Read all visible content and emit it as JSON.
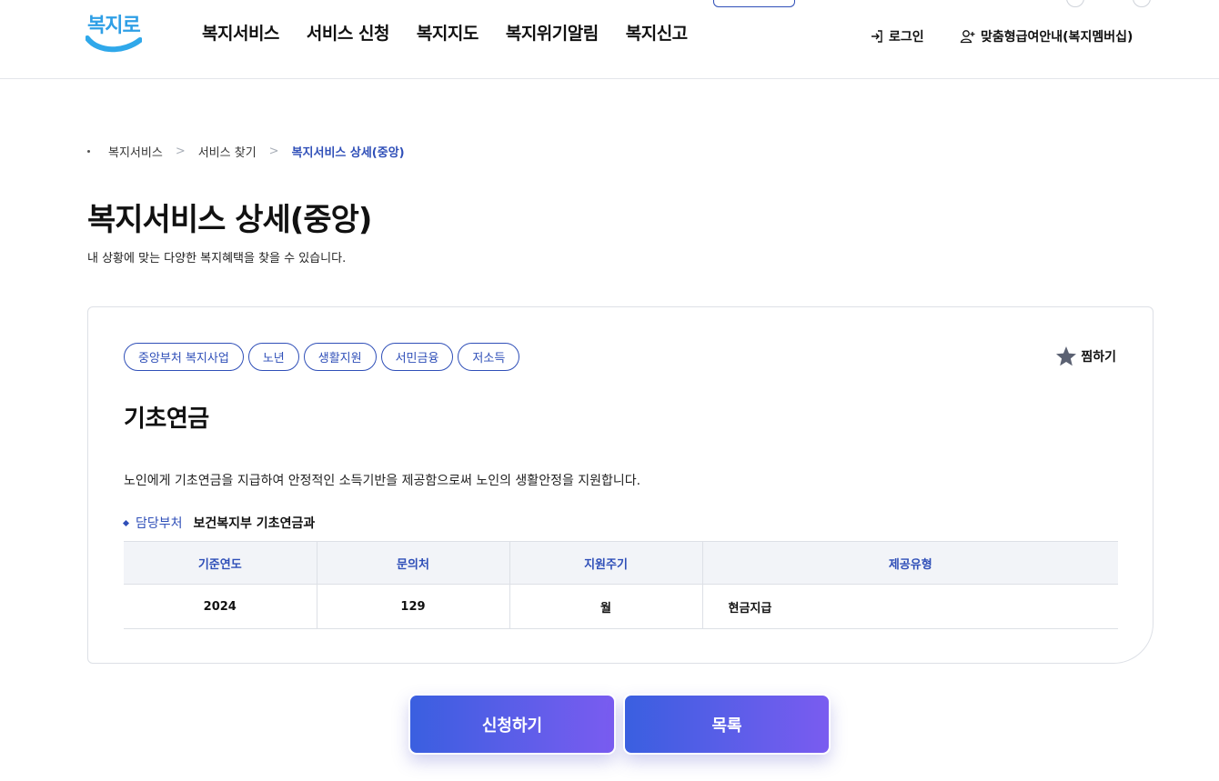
{
  "header": {
    "logo_text": "복지로",
    "nav": [
      {
        "label": "복지서비스"
      },
      {
        "label": "서비스 신청"
      },
      {
        "label": "복지지도"
      },
      {
        "label": "복지위기알림"
      },
      {
        "label": "복지신고"
      }
    ],
    "login_label": "로그인",
    "membership_label": "맞춤형급여안내(복지멤버십)",
    "icons": [
      "login-icon",
      "user-add-icon"
    ]
  },
  "breadcrumb": {
    "items": [
      "복지서비스",
      "서비스 찾기",
      "복지서비스 상세(중앙)"
    ],
    "separator": ">"
  },
  "page": {
    "title": "복지서비스 상세(중앙)",
    "description": "내 상황에 맞는 다양한 복지혜택을 찾을 수 있습니다."
  },
  "service": {
    "tags": [
      "중앙부처 복지사업",
      "노년",
      "생활지원",
      "서민금융",
      "저소득"
    ],
    "bookmark_label": "찜하기",
    "title": "기초연금",
    "description": "노인에게 기초연금을 지급하여 안정적인 소득기반을 제공함으로써 노인의 생활안정을 지원합니다.",
    "department_label": "담당부처",
    "department_value": "보건복지부 기초연금과",
    "table": {
      "headers": [
        "기준연도",
        "문의처",
        "지원주기",
        "제공유형"
      ],
      "row": [
        "2024",
        "129",
        "월",
        "현금지급"
      ]
    }
  },
  "actions": {
    "apply_label": "신청하기",
    "list_label": "목록"
  },
  "colors": {
    "accent": "#2f4fb8",
    "logo": "#2f9fe6",
    "button_gradient_start": "#3a5fe0",
    "button_gradient_end": "#7a5cf0"
  }
}
